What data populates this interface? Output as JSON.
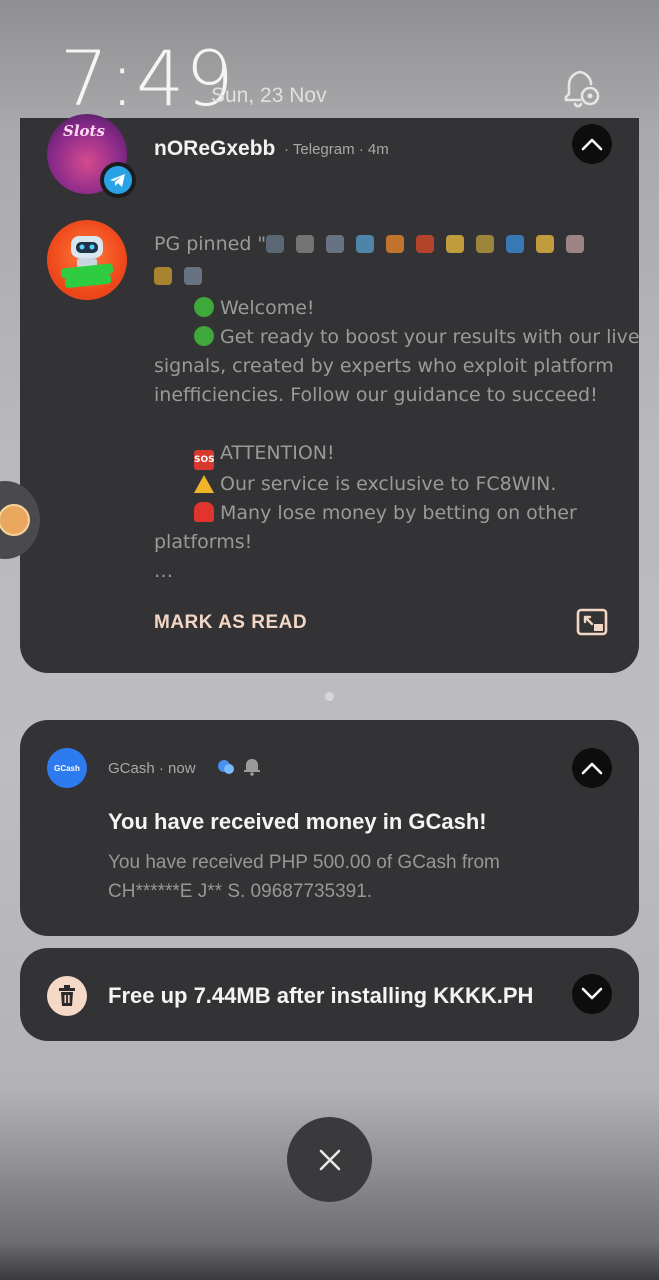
{
  "status_bar": {
    "time": "7:49",
    "date": "Sun, 23 Nov",
    "icons": [
      "bell-settings-icon"
    ]
  },
  "telegram_notification": {
    "sender": "nOReGxebb",
    "app": "Telegram",
    "time_ago": "4m",
    "meta": "· Telegram · 4m",
    "message_lines": [
      "PG pinned \"",
      "Welcome!",
      "Get ready to boost your results with our live",
      "signals, created by experts who exploit platform",
      "inefficiencies. Follow our guidance to succeed!",
      "ATTENTION!",
      "Our service is exclusive to FC8WIN.",
      "Many lose money by betting on other",
      "platforms!",
      "…"
    ],
    "avatar_label": "Slots",
    "action_label": "MARK AS READ",
    "icons": [
      "telegram-icon",
      "chevron-up-icon",
      "picture-in-picture-icon"
    ]
  },
  "gcash_notification": {
    "app": "GCash",
    "time": "now",
    "meta": "GCash · now",
    "logo_text": "GCash",
    "title": "You have received money in GCash!",
    "body_lines": [
      "You have received PHP 500.00 of GCash from",
      "CH******E J** S. 09687735391."
    ],
    "icons": [
      "chat-bubble-icon",
      "bell-icon",
      "chevron-up-icon"
    ]
  },
  "storage_notification": {
    "title": "Free up 7.44MB after installing KKKK.PH",
    "icons": [
      "trash-icon",
      "chevron-down-icon"
    ]
  },
  "dismiss": {
    "icons": [
      "close-icon"
    ]
  },
  "colors": {
    "card_bg": "#333335",
    "accent_action": "#f3d6c4",
    "gcash_blue": "#2e7bf0",
    "telegram_blue": "#2aa3e6"
  }
}
